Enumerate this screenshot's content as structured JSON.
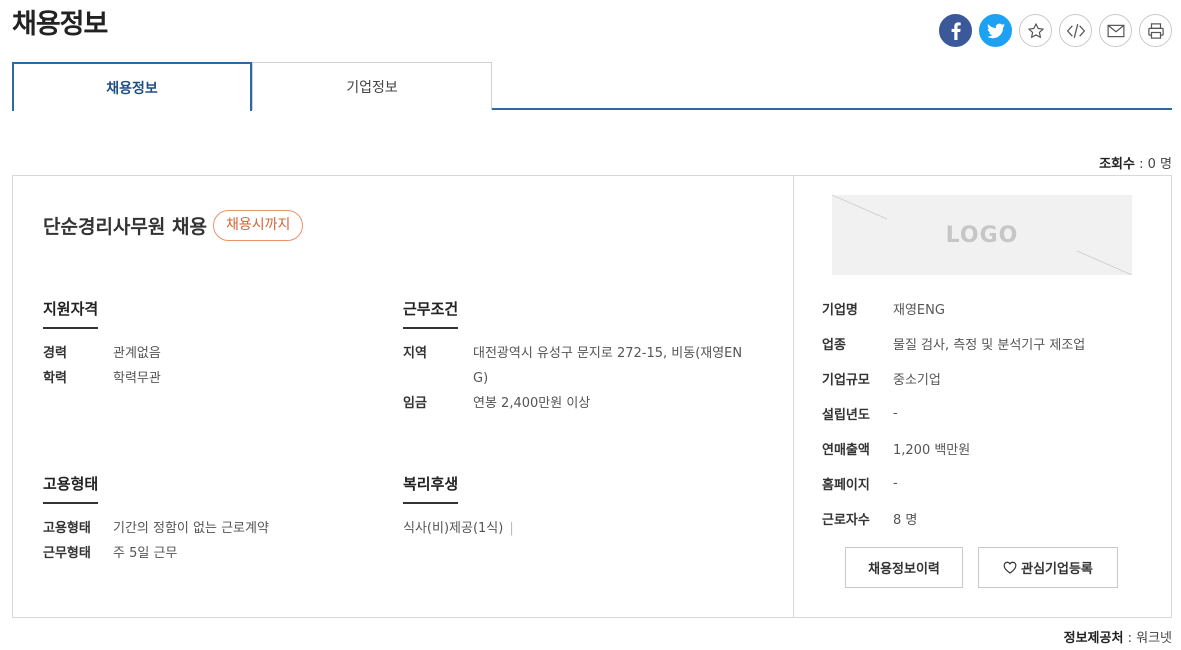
{
  "page": {
    "title": "채용정보"
  },
  "share": {
    "icons": [
      "facebook-icon",
      "twitter-icon",
      "star-icon",
      "code-embed-icon",
      "mail-icon",
      "print-icon"
    ],
    "colors": {
      "facebook": "#3b5998",
      "twitter": "#1da1f2"
    }
  },
  "tabs": [
    {
      "label": "채용정보",
      "active": true
    },
    {
      "label": "기업정보",
      "active": false
    }
  ],
  "views": {
    "label": "조회수",
    "value": "0 명"
  },
  "job": {
    "title": "단순경리사무원 채용",
    "deadline": "채용시까지"
  },
  "qualification": {
    "title": "지원자격",
    "rows": [
      {
        "label": "경력",
        "value": "관계없음"
      },
      {
        "label": "학력",
        "value": "학력무관"
      }
    ]
  },
  "conditions": {
    "title": "근무조건",
    "rows": [
      {
        "label": "지역",
        "value": "대전광역시 유성구 문지로 272-15, 비동(재영ENG)"
      },
      {
        "label": "임금",
        "value": "연봉 2,400만원 이상"
      }
    ]
  },
  "employment": {
    "title": "고용형태",
    "rows": [
      {
        "label": "고용형태",
        "value": "기간의 정함이 없는 근로계약"
      },
      {
        "label": "근무형태",
        "value": "주 5일 근무"
      }
    ]
  },
  "welfare": {
    "title": "복리후생",
    "text": "식사(비)제공(1식)"
  },
  "company": {
    "logo_text": "LOGO",
    "rows": [
      {
        "label": "기업명",
        "value": "재영ENG"
      },
      {
        "label": "업종",
        "value": "물질 검사, 측정 및 분석기구 제조업"
      },
      {
        "label": "기업규모",
        "value": "중소기업"
      },
      {
        "label": "설립년도",
        "value": "-"
      },
      {
        "label": "연매출액",
        "value": "1,200 백만원"
      },
      {
        "label": "홈페이지",
        "value": "-"
      },
      {
        "label": "근로자수",
        "value": "8 명"
      }
    ]
  },
  "buttons": {
    "history": "채용정보이력",
    "favorite": "관심기업등록"
  },
  "provider": {
    "label": "정보제공처",
    "value": "워크넷"
  }
}
